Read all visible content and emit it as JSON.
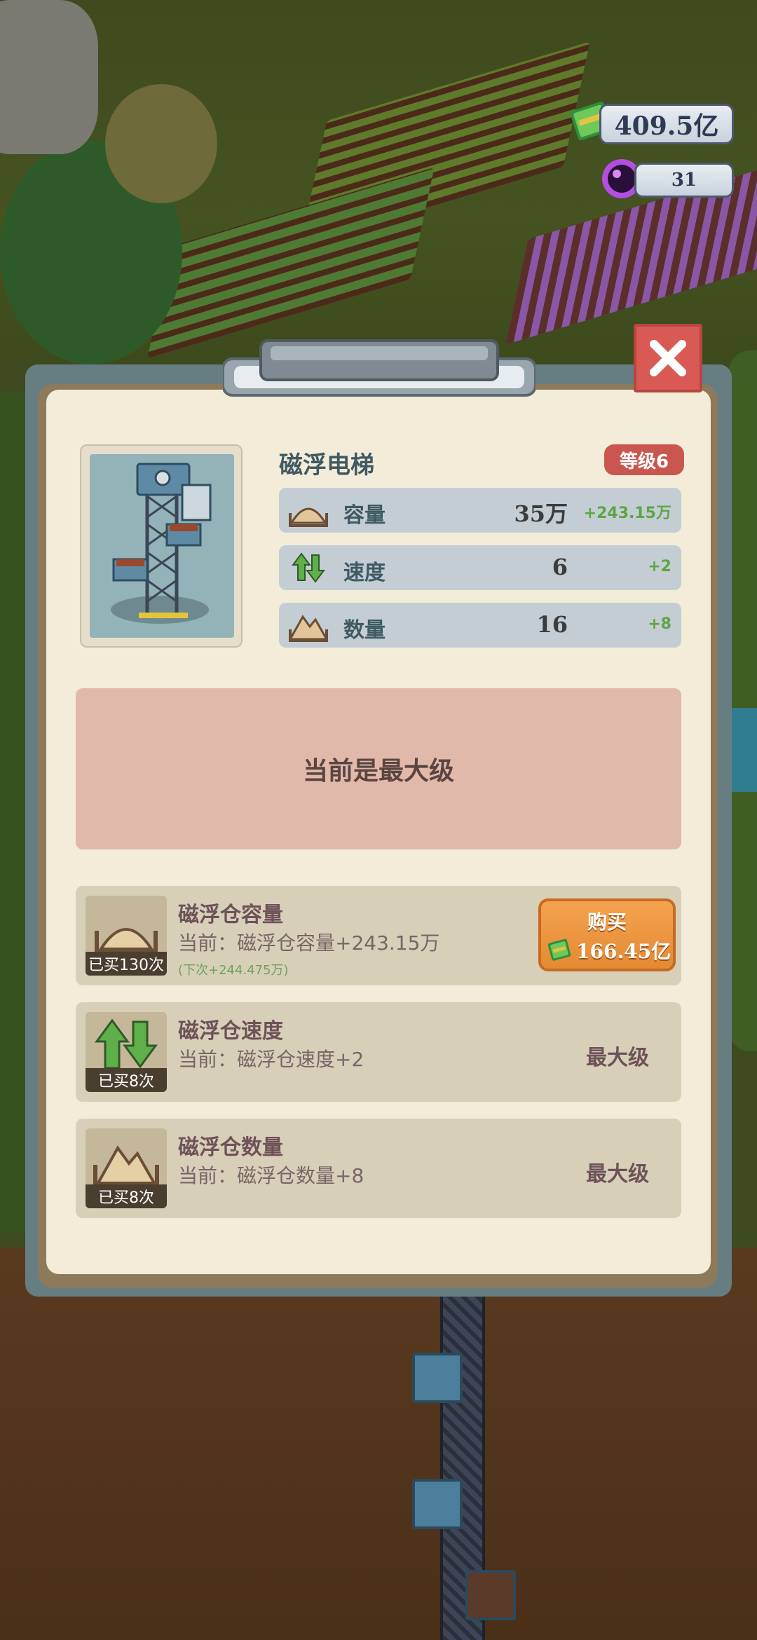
{
  "resources": {
    "money": "409.5亿",
    "gems": "31"
  },
  "building": {
    "name": "磁浮电梯",
    "level": "等级6"
  },
  "stats": [
    {
      "label": "容量",
      "value": "35万",
      "delta": "+243.15万",
      "icon": "sand-pile-icon"
    },
    {
      "label": "速度",
      "value": "6",
      "delta": "+2",
      "icon": "speed-arrows-icon"
    },
    {
      "label": "数量",
      "value": "16",
      "delta": "+8",
      "icon": "mountain-icon"
    }
  ],
  "max_level_text": "当前是最大级",
  "upgrades": [
    {
      "name": "磁浮仓容量",
      "bought": "已买130次",
      "current": "当前：磁浮仓容量+243.15万",
      "next": "(下次+244.475万)",
      "buy_label": "购买",
      "price": "166.45亿",
      "icon": "sand-pile-icon"
    },
    {
      "name": "磁浮仓速度",
      "bought": "已买8次",
      "current": "当前：磁浮仓速度+2",
      "status": "最大级",
      "icon": "speed-arrows-icon"
    },
    {
      "name": "磁浮仓数量",
      "bought": "已买8次",
      "current": "当前：磁浮仓数量+8",
      "status": "最大级",
      "icon": "mountain-icon"
    }
  ],
  "colors": {
    "panel": "#f3ecd8",
    "stat_bg": "#c4cdd4",
    "max_box": "#e1b9ab",
    "level_badge": "#c9574f",
    "buy_button": "#e48a33",
    "delta_green": "#5ea545",
    "close_button": "#d95a54"
  }
}
